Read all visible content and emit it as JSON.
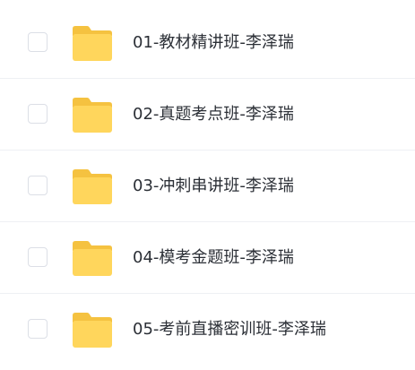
{
  "file_list": {
    "items": [
      {
        "name": "01-教材精讲班-李泽瑞",
        "icon": "folder-icon",
        "checked": false
      },
      {
        "name": "02-真题考点班-李泽瑞",
        "icon": "folder-icon",
        "checked": false
      },
      {
        "name": "03-冲刺串讲班-李泽瑞",
        "icon": "folder-icon",
        "checked": false
      },
      {
        "name": "04-模考金题班-李泽瑞",
        "icon": "folder-icon",
        "checked": false
      },
      {
        "name": "05-考前直播密训班-李泽瑞",
        "icon": "folder-icon",
        "checked": false
      }
    ]
  },
  "colors": {
    "folder_body": "#ffd65c",
    "folder_tab": "#f5c240",
    "text": "#2b2f36",
    "divider": "#eef0f4",
    "checkbox_border": "#dcdfe6"
  }
}
